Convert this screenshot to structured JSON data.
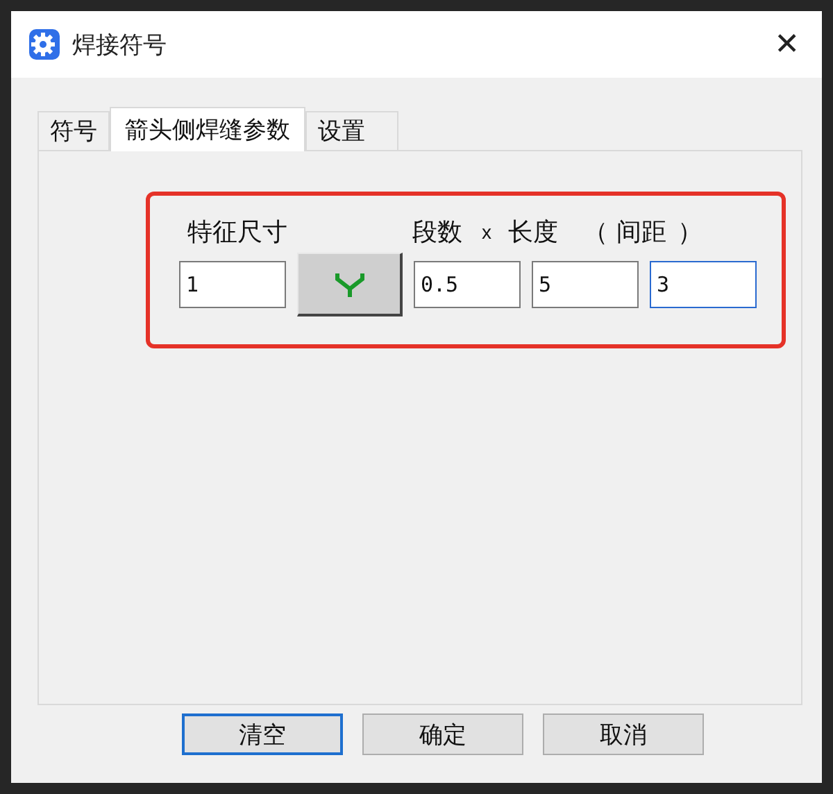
{
  "window": {
    "title": "焊接符号",
    "close": "✕"
  },
  "tabs": [
    {
      "label": "符号",
      "selected": false
    },
    {
      "label": "箭头侧焊缝参数",
      "selected": true
    },
    {
      "label": "设置",
      "selected": false
    }
  ],
  "params": {
    "highlighted": true,
    "headers": [
      {
        "label": "特征尺寸"
      },
      {
        "label": "段数"
      },
      {
        "label": "x"
      },
      {
        "label": "长度"
      },
      {
        "label": "（"
      },
      {
        "label": "间距"
      },
      {
        "label": "）"
      }
    ],
    "fields": [
      {
        "kind": "field",
        "value": "1",
        "focused": false
      },
      {
        "kind": "symbol",
        "color": "#1a9a2a"
      },
      {
        "kind": "field",
        "value": "0.5",
        "focused": false
      },
      {
        "kind": "field",
        "value": "5",
        "focused": false
      },
      {
        "kind": "field",
        "value": "3",
        "focused": true
      }
    ]
  },
  "buttons": [
    {
      "label": "清空",
      "default": true
    },
    {
      "label": "确定",
      "default": false
    },
    {
      "label": "取消",
      "default": false
    }
  ]
}
